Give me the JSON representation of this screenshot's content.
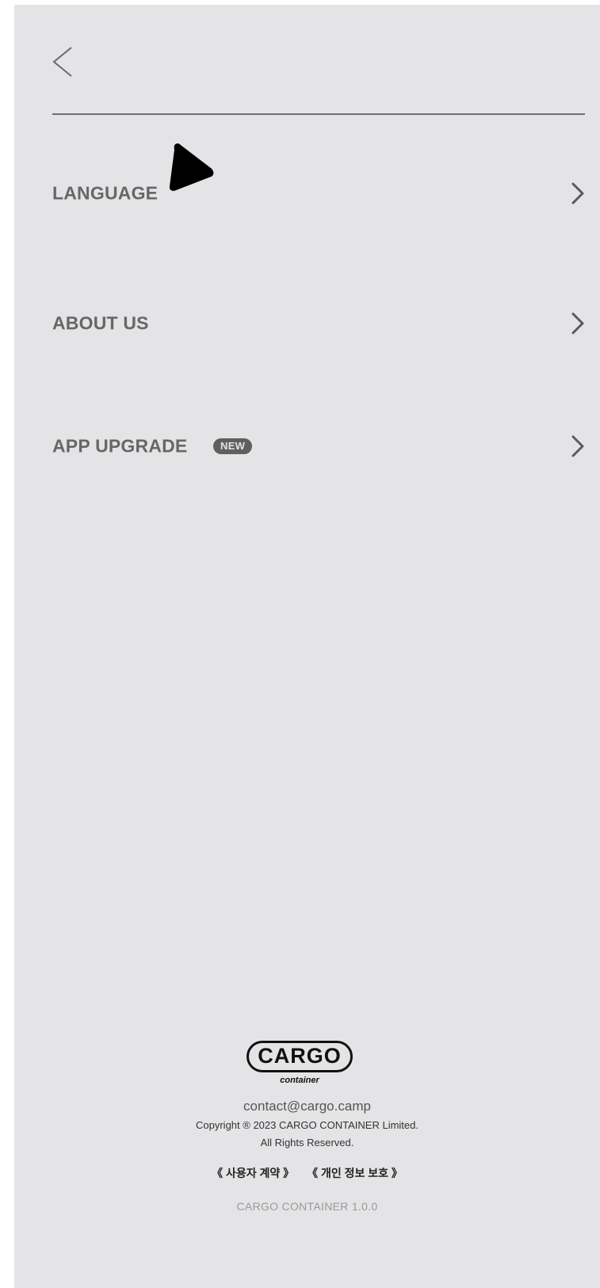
{
  "header": {
    "back_icon": "chevron-left-icon"
  },
  "menu": {
    "items": [
      {
        "label": "LANGUAGE",
        "icon": "chevron-right-icon"
      },
      {
        "label": "ABOUT US",
        "icon": "chevron-right-icon"
      },
      {
        "label": "APP UPGRADE",
        "badge": "NEW",
        "icon": "chevron-right-icon"
      }
    ]
  },
  "footer": {
    "logo_text": "CARGO",
    "logo_sub": "container",
    "contact": "contact@cargo.camp",
    "copyright": "Copyright ® 2023 CARGO CONTAINER Limited.",
    "rights": "All Rights Reserved.",
    "terms_link": "《 사용자 계약 》",
    "privacy_link": "《 개인 정보 보호 》",
    "version": "CARGO CONTAINER 1.0.0"
  },
  "colors": {
    "background": "#e4e4e6",
    "label": "#676767",
    "badge_bg": "#5f5f5f"
  }
}
